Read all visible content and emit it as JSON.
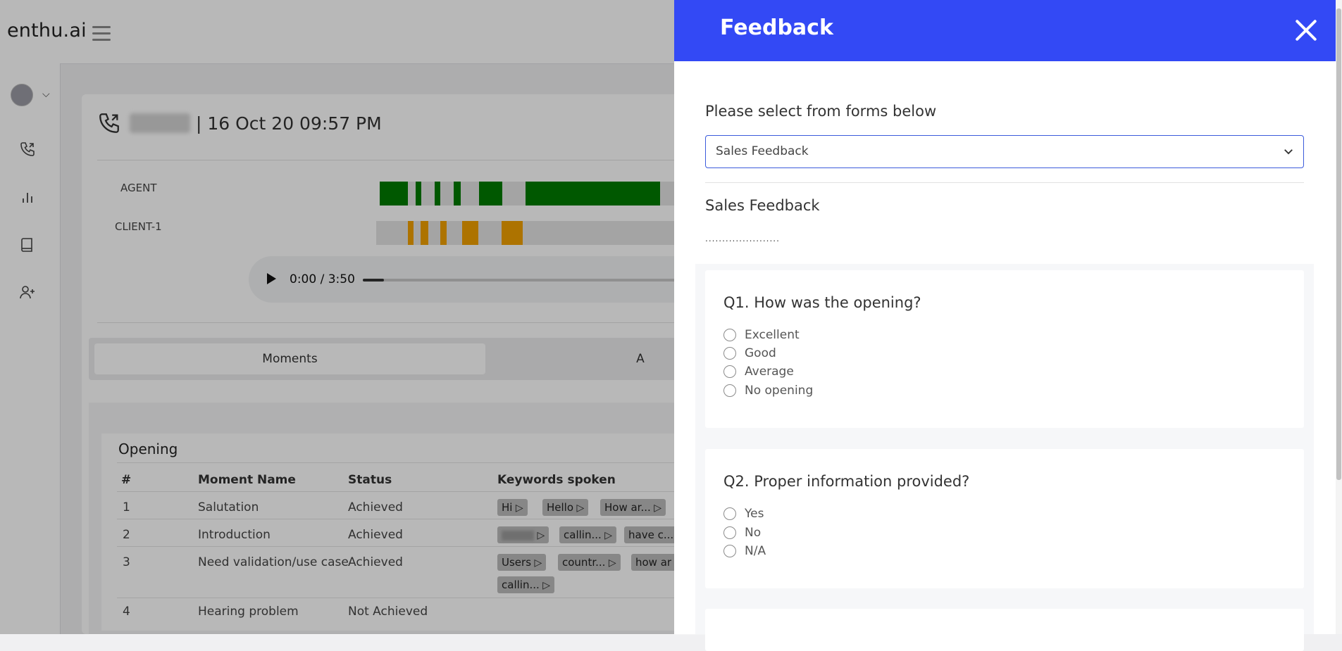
{
  "app": {
    "logo": "enthu.ai"
  },
  "sidebar": {
    "icons": [
      "phone-icon",
      "bar-chart-icon",
      "book-icon",
      "add-user-icon"
    ]
  },
  "call": {
    "date_label": "| 16 Oct 20 09:57 PM",
    "tracks": [
      {
        "label": "AGENT",
        "color": "#007a00"
      },
      {
        "label": "CLIENT-1",
        "color": "#f0a000"
      }
    ],
    "player": {
      "time": "0:00 / 3:50",
      "progress": 0.05
    }
  },
  "tabs": [
    {
      "label": "Moments"
    },
    {
      "label": "A"
    }
  ],
  "moments": {
    "section_title": "Opening",
    "headers": [
      "#",
      "Moment Name",
      "Status",
      "Keywords spoken"
    ],
    "rows": [
      {
        "num": "1",
        "name": "Salutation",
        "status": "Achieved",
        "keywords": [
          "Hi",
          "Hello",
          "How ar..."
        ]
      },
      {
        "num": "2",
        "name": "Introduction",
        "status": "Achieved",
        "keywords": [
          "callin...",
          "have c..."
        ]
      },
      {
        "num": "3",
        "name": "Need validation/use case",
        "status": "Achieved",
        "keywords": [
          "Users",
          "countr...",
          "how ar",
          "callin..."
        ]
      },
      {
        "num": "4",
        "name": "Hearing problem",
        "status": "Not Achieved",
        "keywords": []
      }
    ]
  },
  "feedback": {
    "title": "Feedback",
    "select_label": "Please select from forms below",
    "selected_form": "Sales Feedback",
    "form_title": "Sales Feedback",
    "form_desc": "......................",
    "questions": [
      {
        "title": "Q1. How was the opening?",
        "options": [
          "Excellent",
          "Good",
          "Average",
          "No opening"
        ]
      },
      {
        "title": "Q2. Proper information provided?",
        "options": [
          "Yes",
          "No",
          "N/A"
        ]
      }
    ]
  },
  "colors": {
    "panel_header": "#3349f5",
    "agent_track": "#007a00",
    "client_track": "#f0a000"
  }
}
